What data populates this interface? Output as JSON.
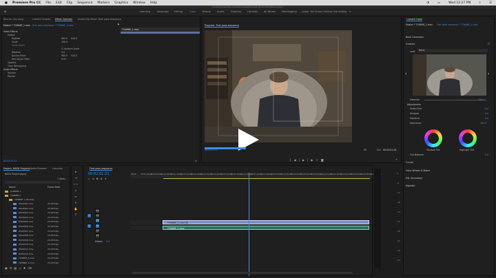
{
  "menubar": {
    "apple": "",
    "items": [
      "Premiere Pro CC",
      "File",
      "Edit",
      "Clip",
      "Sequence",
      "Markers",
      "Graphics",
      "Window",
      "Help"
    ],
    "clock": "Wed 12:27 PM"
  },
  "titlebar": "/Users/johnwolf/Documents/Adobe/Premiere Pro/12.0/Untitled.prproj *",
  "workspaces": [
    "Learning",
    "Assembly",
    "Editing",
    "Color",
    "Effects",
    "Audio",
    "Graphics",
    "Libraries",
    "All Panels",
    "Metalogging",
    "Lower 3rd Screen Editing",
    "Live editing"
  ],
  "effect_controls": {
    "tabs": [
      "Source: (no clips)",
      "Lumetri Scopes",
      "Effect Controls",
      "Audio Clip Mixer: First pass sequence"
    ],
    "header": "Master * TOWNIE_1.mov",
    "header_seq": "First pass sequence * TOWNIE_1.mov",
    "section_video": "Video Effects",
    "motion": "Motion",
    "position": "Position",
    "position_x": "960.0",
    "position_y": "540.0",
    "scale": "Scale",
    "scale_val": "100.0",
    "scale_width": "Scale Width",
    "uniform": "Uniform Scale",
    "rotation": "Rotation",
    "rotation_val": "0.0",
    "anchor": "Anchor Point",
    "anchor_x": "960.0",
    "anchor_y": "540.0",
    "flicker": "Anti-flicker Filter",
    "flicker_val": "0.00",
    "opacity": "Opacity",
    "time_remap": "Time Remapping",
    "section_audio": "Audio Effects",
    "volume": "Volume",
    "panner": "Panner",
    "clip_label": "TOWNIE_1.mov",
    "timecode": "00:02:01:21"
  },
  "program": {
    "title": "Program: First pass sequence",
    "fit": "Fit",
    "full": "Full",
    "timecode": "00:02:01:21",
    "duration": "00:03:01:04"
  },
  "lumetri": {
    "title": "Lumetri Color",
    "master": "Master * TOWNIE_1.mov",
    "seq": "First pass sequence * TOWNIE_1.mov",
    "basic": "Basic Correction",
    "creative": "Creative",
    "look_label": "Look",
    "look_value": "None",
    "intensity": "Intensity",
    "intensity_val": "100.0",
    "adjustments": "Adjustments",
    "faded": "Faded Film",
    "faded_val": "0.0",
    "sharpen": "Sharpen",
    "sharpen_val": "0.0",
    "vibrance": "Vibrance",
    "vibrance_val": "0.0",
    "saturation": "Saturation",
    "saturation_val": "100.0",
    "shadow": "Shadow Tint",
    "highlight": "Highlight Tint",
    "tint_balance": "Tint Balance",
    "tint_balance_val": "0.0",
    "curves": "Curves",
    "color_wheels": "Color Wheels & Match",
    "hsl": "HSL Secondary",
    "vignette": "Vignette"
  },
  "project": {
    "tabs": [
      "Project: NASfr Projects",
      "Media Browser",
      "Libraries",
      "Info"
    ],
    "search_placeholder": "NASfr Project.prproj",
    "col_name": "Name",
    "col_rate": "Frame Rate",
    "folders": [
      "SCREEN 1",
      "SCREEN 2",
      "TOWNIE 1 (Townie)"
    ],
    "files": [
      {
        "name": "DSC0001.mov",
        "rate": "23.976 fps"
      },
      {
        "name": "DSC0002.mov",
        "rate": "23.976 fps"
      },
      {
        "name": "DSC0003.mov",
        "rate": "23.976 fps"
      },
      {
        "name": "DSC0004.mov",
        "rate": "23.976 fps"
      },
      {
        "name": "DSC0005.mov",
        "rate": "23.976 fps"
      },
      {
        "name": "DSC0006.mov",
        "rate": "23.976 fps"
      },
      {
        "name": "DSC0007.mov",
        "rate": "23.976 fps"
      },
      {
        "name": "DSC0008.mov",
        "rate": "23.976 fps"
      },
      {
        "name": "DSC0009.mov",
        "rate": "23.976 fps"
      },
      {
        "name": "DSC0010.mov",
        "rate": "23.976 fps"
      },
      {
        "name": "DSC0011.mov",
        "rate": "23.976 fps"
      },
      {
        "name": "DSC0012.mov",
        "rate": "23.976 fps"
      },
      {
        "name": "TOWNIE_1.mov",
        "rate": "23.976 fps"
      },
      {
        "name": "TOWNIE_2.mov",
        "rate": "23.976 fps"
      }
    ],
    "item_count": "7 items"
  },
  "timeline": {
    "title": "First pass sequence",
    "timecode": "00:02:01:21",
    "ruler": [
      "00:00",
      "00:01:00:00",
      "00:01:04:00",
      "00:01:08:00",
      "00:01:12:00",
      "00:01:16:00",
      "00:01:20:00",
      "00:01:24:00",
      "00:01:28:00",
      "00:01:32:00",
      "00:01:36:00",
      "00:01:40:00",
      "00:01:44:00",
      "00:01:48:00",
      "00:01:52:00",
      "00:01:56:00",
      "00:02:00:00",
      "00:02:04:00",
      "00:02:08:00",
      "00:02:12:00",
      "00:02:16:00",
      "00:02:20:00",
      "00:02:24:00",
      "00:02:28:00",
      "00:02:32:00"
    ],
    "tracks": [
      "V3",
      "V2",
      "V1",
      "A1",
      "A2",
      "A3"
    ],
    "master": "Master",
    "master_val": "0.0",
    "clip_v": "TOWNIE_1.mov [V]",
    "clip_a": "TOWNIE_1.mov"
  },
  "meter_labels": [
    "0",
    "-6",
    "-12",
    "-18",
    "-24",
    "-30",
    "-36",
    "-42",
    "-48",
    "-54"
  ],
  "colors": {
    "accent": "#3d8ee8",
    "video_clip": "#7a8fc7",
    "audio_clip": "#2f6f5f"
  }
}
